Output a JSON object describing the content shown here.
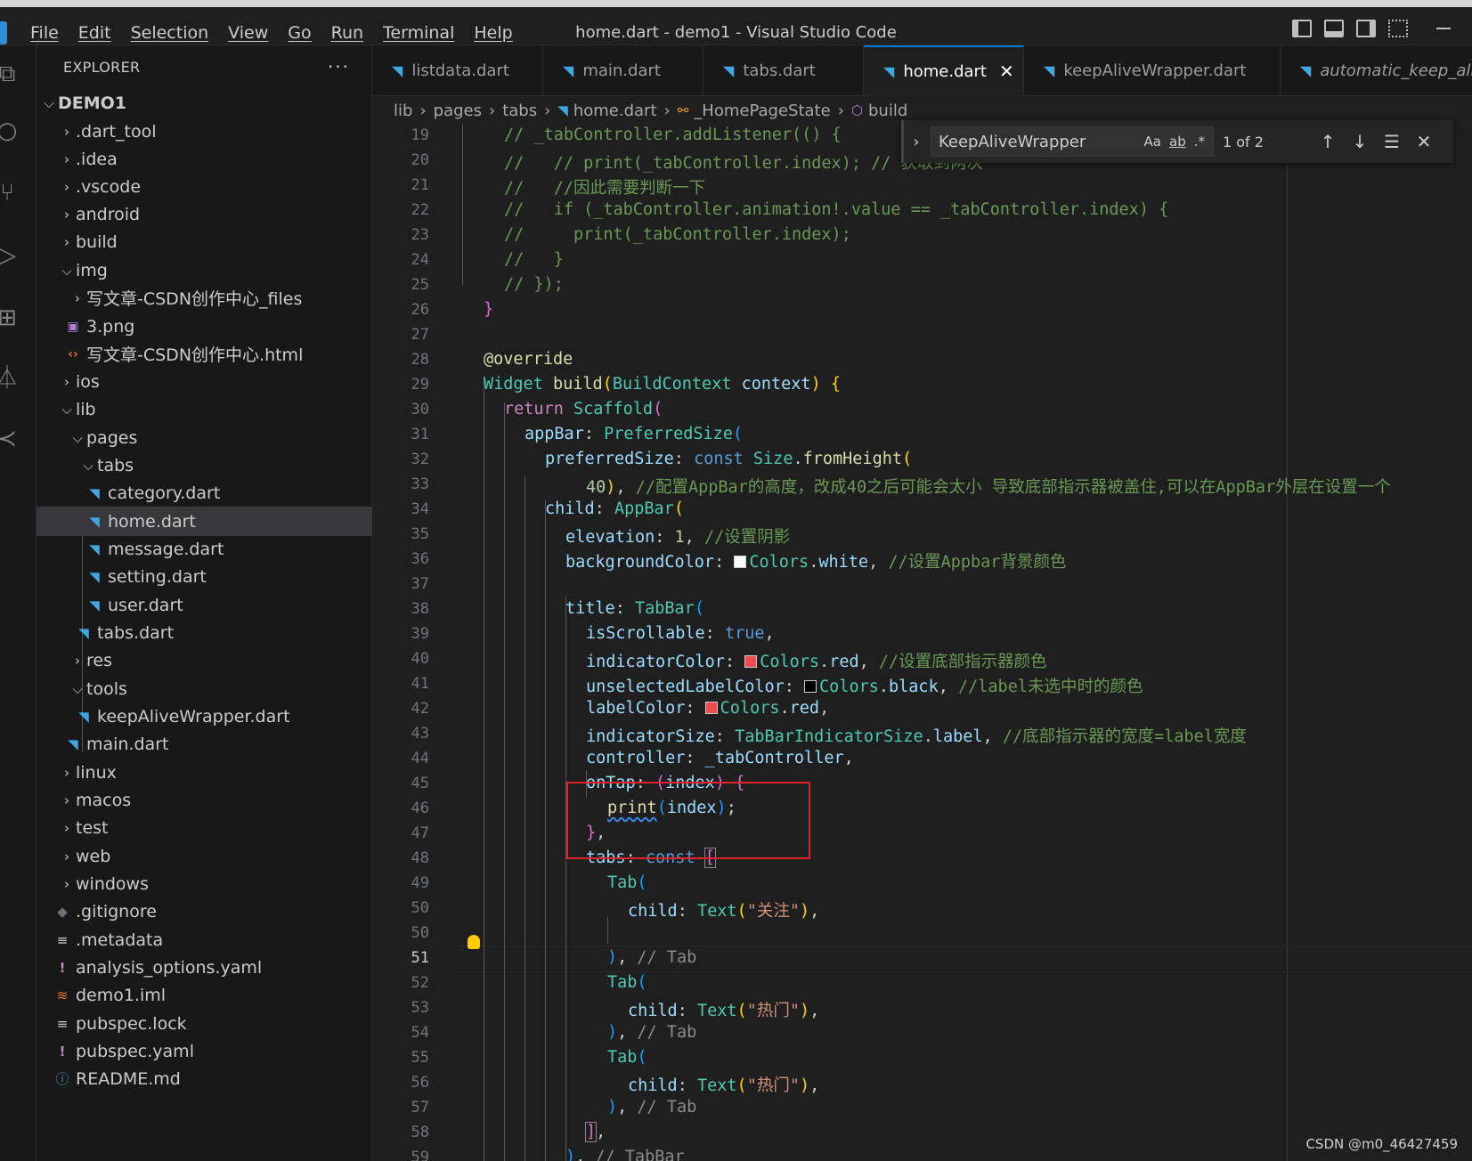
{
  "window": {
    "title": "home.dart - demo1 - Visual Studio Code",
    "menu": [
      "File",
      "Edit",
      "Selection",
      "View",
      "Go",
      "Run",
      "Terminal",
      "Help"
    ]
  },
  "explorer": {
    "header": "EXPLORER",
    "more": "···",
    "items": [
      {
        "label": "DEMO1",
        "chevron": "⌵"
      },
      {
        "label": ".dart_tool",
        "chevron": "›"
      },
      {
        "label": ".idea",
        "chevron": "›"
      },
      {
        "label": ".vscode",
        "chevron": "›"
      },
      {
        "label": "android",
        "chevron": "›"
      },
      {
        "label": "build",
        "chevron": "›"
      },
      {
        "label": "img",
        "chevron": "⌵"
      },
      {
        "label": "写文章-CSDN创作中心_files",
        "chevron": "›"
      },
      {
        "label": "3.png"
      },
      {
        "label": "写文章-CSDN创作中心.html"
      },
      {
        "label": "ios",
        "chevron": "›"
      },
      {
        "label": "lib",
        "chevron": "⌵"
      },
      {
        "label": "pages",
        "chevron": "⌵"
      },
      {
        "label": "tabs",
        "chevron": "⌵"
      },
      {
        "label": "category.dart"
      },
      {
        "label": "home.dart"
      },
      {
        "label": "message.dart"
      },
      {
        "label": "setting.dart"
      },
      {
        "label": "user.dart"
      },
      {
        "label": "tabs.dart"
      },
      {
        "label": "res",
        "chevron": "›"
      },
      {
        "label": "tools",
        "chevron": "⌵"
      },
      {
        "label": "keepAliveWrapper.dart"
      },
      {
        "label": "main.dart"
      },
      {
        "label": "linux",
        "chevron": "›"
      },
      {
        "label": "macos",
        "chevron": "›"
      },
      {
        "label": "test",
        "chevron": "›"
      },
      {
        "label": "web",
        "chevron": "›"
      },
      {
        "label": "windows",
        "chevron": "›"
      },
      {
        "label": ".gitignore"
      },
      {
        "label": ".metadata"
      },
      {
        "label": "analysis_options.yaml"
      },
      {
        "label": "demo1.iml"
      },
      {
        "label": "pubspec.lock"
      },
      {
        "label": "pubspec.yaml"
      },
      {
        "label": "README.md"
      }
    ]
  },
  "tabs": [
    {
      "label": "listdata.dart"
    },
    {
      "label": "main.dart"
    },
    {
      "label": "tabs.dart"
    },
    {
      "label": "home.dart",
      "close": "✕"
    },
    {
      "label": "keepAliveWrapper.dart"
    },
    {
      "label": "automatic_keep_alive"
    }
  ],
  "breadcrumb": {
    "items": [
      "lib",
      "pages",
      "tabs",
      "home.dart",
      "_HomePageState",
      "build"
    ],
    "sep": "›"
  },
  "find": {
    "toggle": "›",
    "value": "KeepAliveWrapper",
    "opt_case": "Aa",
    "opt_word": "ab",
    "opt_regex": ".*",
    "count": "1 of 2",
    "prev": "↑",
    "next": "↓",
    "selection": "☰",
    "close": "✕"
  },
  "editor": {
    "line_numbers": [
      "19",
      "20",
      "21",
      "22",
      "23",
      "24",
      "25",
      "26",
      "27",
      "28",
      "29",
      "30",
      "31",
      "32",
      "33",
      "34",
      "35",
      "36",
      "37",
      "38",
      "39",
      "40",
      "41",
      "42",
      "43",
      "44",
      "45",
      "46",
      "47",
      "48",
      "49",
      "50",
      "51",
      "52",
      "53",
      "54",
      "55",
      "56",
      "57",
      "58",
      "59"
    ],
    "current_line": "51",
    "colors": {
      "red": "#f14c4c",
      "white": "#ffffff",
      "black": "#000000"
    },
    "t": {
      "c19": "// _tabController.addListener(() {",
      "c20": "//   // print(_tabController.index); // 获取到两次",
      "c21": "//   //因此需要判断一下",
      "c22": "//   if (_tabController.animation!.value == _tabController.index) {",
      "c23": "//     print(_tabController.index);",
      "c24": "//   }",
      "c25": "// });",
      "c26": "}",
      "c28": "@override",
      "c29_a": "Widget ",
      "c29_b": "build",
      "c29_c": "(",
      "c29_d": "BuildContext ",
      "c29_e": "context",
      "c29_f": ") ",
      "c29_g": "{",
      "c30_a": "return ",
      "c30_b": "Scaffold",
      "c30_c": "(",
      "c31_a": "appBar",
      "c31_b": ": ",
      "c31_c": "PreferredSize",
      "c31_d": "(",
      "c32_a": "preferredSize",
      "c32_b": ": ",
      "c32_c": "const ",
      "c32_d": "Size",
      "c32_e": ".",
      "c32_f": "fromHeight",
      "c32_g": "(",
      "c33_a": "40",
      "c33_b": ")",
      "c33_c": ", ",
      "c33_d": "//配置AppBar的高度，改成40之后可能会太小 导致底部指示器被盖住,可以在AppBar外层在设置一个",
      "c34_a": "child",
      "c34_b": ": ",
      "c34_c": "AppBar",
      "c34_d": "(",
      "c35_a": "elevation",
      "c35_b": ": ",
      "c35_c": "1",
      "c35_d": ", ",
      "c35_e": "//设置阴影",
      "c36_a": "backgroundColor",
      "c36_b": ": ",
      "c36_c": "Colors",
      "c36_d": ".",
      "c36_e": "white",
      "c36_f": ", ",
      "c36_g": "//设置Appbar背景颜色",
      "c38_a": "title",
      "c38_b": ": ",
      "c38_c": "TabBar",
      "c38_d": "(",
      "c39_a": "isScrollable",
      "c39_b": ": ",
      "c39_c": "true",
      "c39_d": ",",
      "c40_a": "indicatorColor",
      "c40_b": ": ",
      "c40_c": "Colors",
      "c40_d": ".",
      "c40_e": "red",
      "c40_f": ", ",
      "c40_g": "//设置底部指示器颜色",
      "c41_a": "unselectedLabelColor",
      "c41_b": ": ",
      "c41_c": "Colors",
      "c41_d": ".",
      "c41_e": "black",
      "c41_f": ", ",
      "c41_g": "//label未选中时的颜色",
      "c42_a": "labelColor",
      "c42_b": ": ",
      "c42_c": "Colors",
      "c42_d": ".",
      "c42_e": "red",
      "c42_f": ",",
      "c43_a": "indicatorSize",
      "c43_b": ": ",
      "c43_c": "TabBarIndicatorSize",
      "c43_d": ".",
      "c43_e": "label",
      "c43_f": ", ",
      "c43_g": "//底部指示器的宽度=label宽度",
      "c44_a": "controller",
      "c44_b": ": ",
      "c44_c": "_tabController",
      "c44_d": ",",
      "c45_a": "onTap",
      "c45_b": ": ",
      "c45_c": "(",
      "c45_d": "index",
      "c45_e": ") ",
      "c45_f": "{",
      "c46_a": "print",
      "c46_b": "(",
      "c46_c": "index",
      "c46_d": ")",
      "c46_e": ";",
      "c47_a": "}",
      "c47_b": ",",
      "c48_a": "tabs",
      "c48_b": ": ",
      "c48_c": "const ",
      "c48_d": "[",
      "c49_a": "Tab",
      "c49_b": "(",
      "c50_a": "child",
      "c50_b": ": ",
      "c50_c": "Text",
      "c50_d": "(",
      "c50_e": "\"关注\"",
      "c50_f": ")",
      "c50_g": ",",
      "c51_a": ")",
      "c51_b": ", ",
      "c51_c": "// Tab",
      "c52_a": "Tab",
      "c52_b": "(",
      "c53_a": "child",
      "c53_b": ": ",
      "c53_c": "Text",
      "c53_d": "(",
      "c53_e": "\"热门\"",
      "c53_f": ")",
      "c53_g": ",",
      "c54_a": ")",
      "c54_b": ", ",
      "c54_c": "// Tab",
      "c55_a": "Tab",
      "c55_b": "(",
      "c56_a": "child",
      "c56_b": ": ",
      "c56_c": "Text",
      "c56_d": "(",
      "c56_e": "\"热门\"",
      "c56_f": ")",
      "c56_g": ",",
      "c57_a": ")",
      "c57_b": ", ",
      "c57_c": "// Tab",
      "c58_a": "]",
      "c58_b": ",",
      "c59_a": ")",
      "c59_b": ", ",
      "c59_c": "// TabBar"
    }
  },
  "watermark": "CSDN @m0_46427459"
}
